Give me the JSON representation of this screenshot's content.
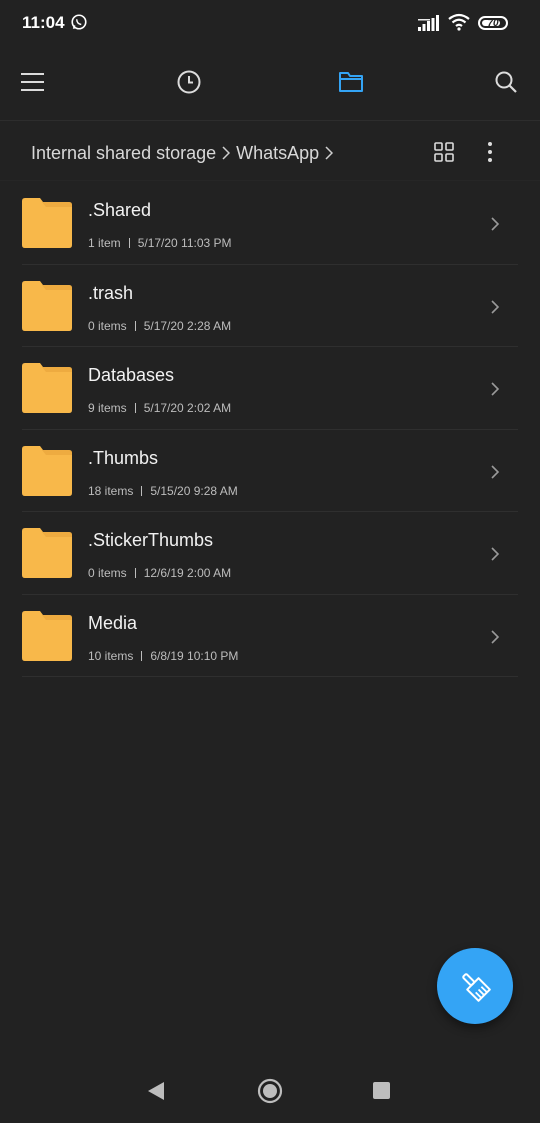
{
  "status_bar": {
    "time": "11:04",
    "battery": "70",
    "icons": [
      "whatsapp-icon",
      "signal-icon",
      "wifi-icon",
      "battery-icon"
    ]
  },
  "toolbar": {
    "icons": [
      "menu-icon",
      "recent-clock-icon",
      "folder-icon",
      "search-icon"
    ],
    "active": "folder-icon",
    "accent_color": "#34a4f5"
  },
  "breadcrumb": {
    "items": [
      "Internal shared storage",
      "WhatsApp"
    ]
  },
  "folders": [
    {
      "name": ".Shared",
      "count": "1 item",
      "date": "5/17/20 11:03 PM"
    },
    {
      "name": ".trash",
      "count": "0 items",
      "date": "5/17/20 2:28 AM"
    },
    {
      "name": "Databases",
      "count": "9 items",
      "date": "5/17/20 2:02 AM"
    },
    {
      "name": ".Thumbs",
      "count": "18 items",
      "date": "5/15/20 9:28 AM"
    },
    {
      "name": ".StickerThumbs",
      "count": "0 items",
      "date": "12/6/19 2:00 AM"
    },
    {
      "name": "Media",
      "count": "10 items",
      "date": "6/8/19 10:10 PM"
    }
  ],
  "folder_color": "#f8b84a",
  "fab": {
    "icon": "clean-brush-icon",
    "color": "#34a4f5"
  },
  "nav": {
    "icons": [
      "back-icon",
      "home-icon",
      "recents-icon"
    ]
  }
}
